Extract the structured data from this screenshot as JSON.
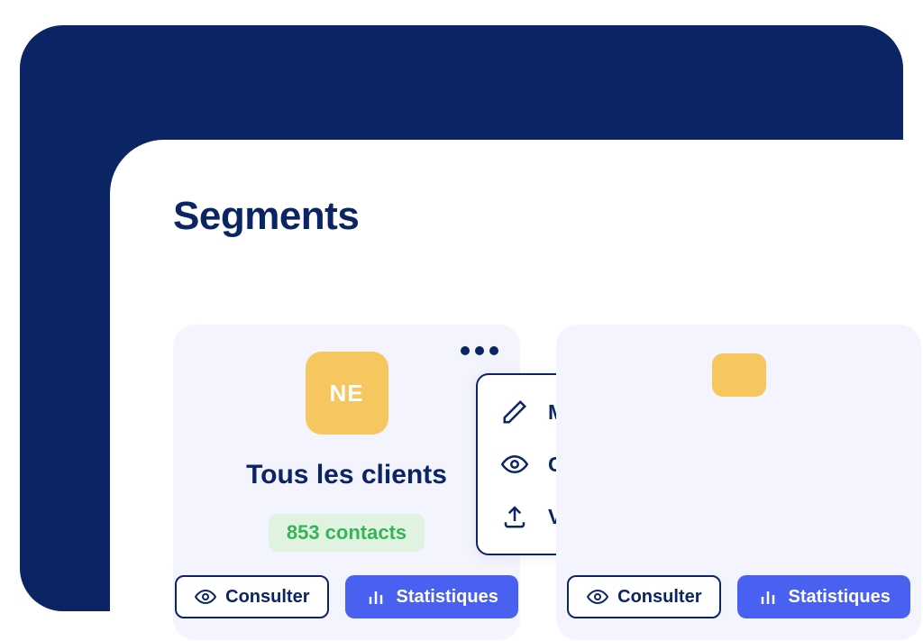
{
  "page": {
    "title": "Segments"
  },
  "cards": [
    {
      "badge": "NE",
      "title": "Tous les clients",
      "contacts": "853 contacts",
      "consult_label": "Consulter",
      "stats_label": "Statistiques"
    },
    {
      "consult_label": "Consulter",
      "stats_label": "Statistiques"
    }
  ],
  "menu": {
    "items": [
      {
        "label": "Modifier"
      },
      {
        "label": "Consulter les contacts"
      },
      {
        "label": "Vers une audience Meta"
      }
    ]
  }
}
